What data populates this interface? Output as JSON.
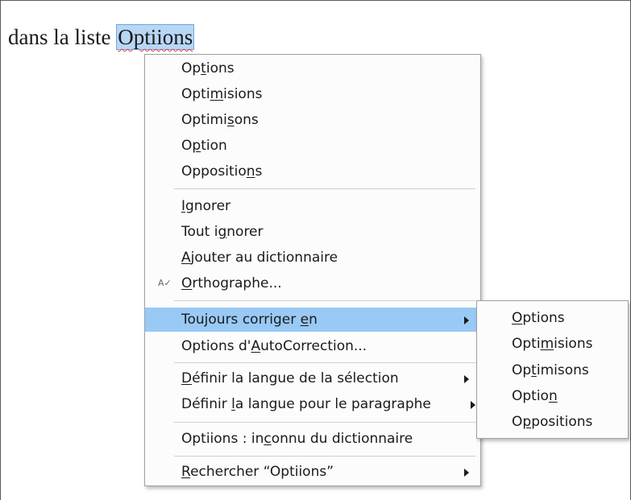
{
  "document": {
    "prefix": "dans la liste ",
    "selected_word": "Optiions"
  },
  "menu": {
    "suggestions": [
      {
        "pre": "Op",
        "acc": "t",
        "post": "ions"
      },
      {
        "pre": "Opti",
        "acc": "m",
        "post": "isions"
      },
      {
        "pre": "Optimi",
        "acc": "s",
        "post": "ons"
      },
      {
        "pre": "O",
        "acc": "p",
        "post": "tion"
      },
      {
        "pre": "Oppositio",
        "acc": "n",
        "post": "s"
      }
    ],
    "ignore": {
      "pre": "",
      "acc": "I",
      "post": "gnorer"
    },
    "ignore_all": {
      "pre": "Tout i",
      "acc": "g",
      "post": "norer"
    },
    "add_to_dictionary": {
      "pre": "",
      "acc": "A",
      "post": "jouter au dictionnaire"
    },
    "spelling": {
      "pre": "",
      "acc": "O",
      "post": "rthographe..."
    },
    "spelling_icon": "Ab-check-icon",
    "always_correct": {
      "pre": "Toujours corriger ",
      "acc": "e",
      "post": "n"
    },
    "autocorrect_options": {
      "pre": "Options d'",
      "acc": "A",
      "post": "utoCorrection..."
    },
    "set_language_selection": {
      "pre": "",
      "acc": "D",
      "post": "éfinir la langue de la sélection"
    },
    "set_language_paragraph": {
      "pre": "Définir ",
      "acc": "l",
      "post": "a langue pour le paragraphe"
    },
    "unknown_word": {
      "pre": "Optiions :  in",
      "acc": "c",
      "post": "onnu du dictionnaire"
    },
    "search": {
      "pre": "",
      "acc": "R",
      "post": "echercher “Optiions”"
    }
  },
  "submenu": {
    "items": [
      {
        "pre": "",
        "acc": "O",
        "post": "ptions"
      },
      {
        "pre": "Opti",
        "acc": "m",
        "post": "isions"
      },
      {
        "pre": "Op",
        "acc": "t",
        "post": "imisons"
      },
      {
        "pre": "Optio",
        "acc": "n",
        "post": ""
      },
      {
        "pre": "O",
        "acc": "p",
        "post": "positions"
      }
    ]
  },
  "colors": {
    "highlight": "#99c9f5",
    "selection": "#b7d7f5",
    "spell_underline": "#e04040"
  }
}
